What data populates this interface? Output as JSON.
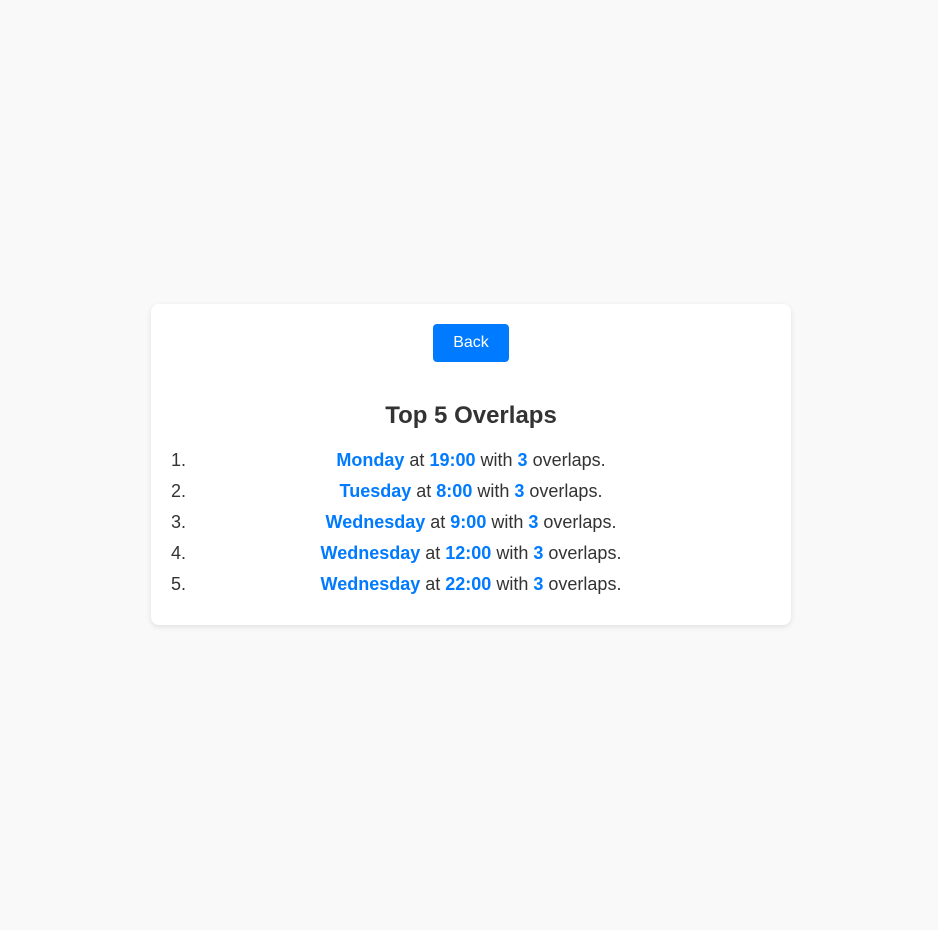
{
  "colors": {
    "accent": "#007bff",
    "text": "#333333",
    "background": "#f9f9f9",
    "card": "#ffffff"
  },
  "back_button": {
    "label": "Back"
  },
  "title": "Top 5 Overlaps",
  "connectors": {
    "at": "at",
    "with": "with",
    "suffix": "overlaps."
  },
  "overlaps": [
    {
      "number": "1.",
      "day": "Monday",
      "time": "19:00",
      "count": "3"
    },
    {
      "number": "2.",
      "day": "Tuesday",
      "time": "8:00",
      "count": "3"
    },
    {
      "number": "3.",
      "day": "Wednesday",
      "time": "9:00",
      "count": "3"
    },
    {
      "number": "4.",
      "day": "Wednesday",
      "time": "12:00",
      "count": "3"
    },
    {
      "number": "5.",
      "day": "Wednesday",
      "time": "22:00",
      "count": "3"
    }
  ]
}
